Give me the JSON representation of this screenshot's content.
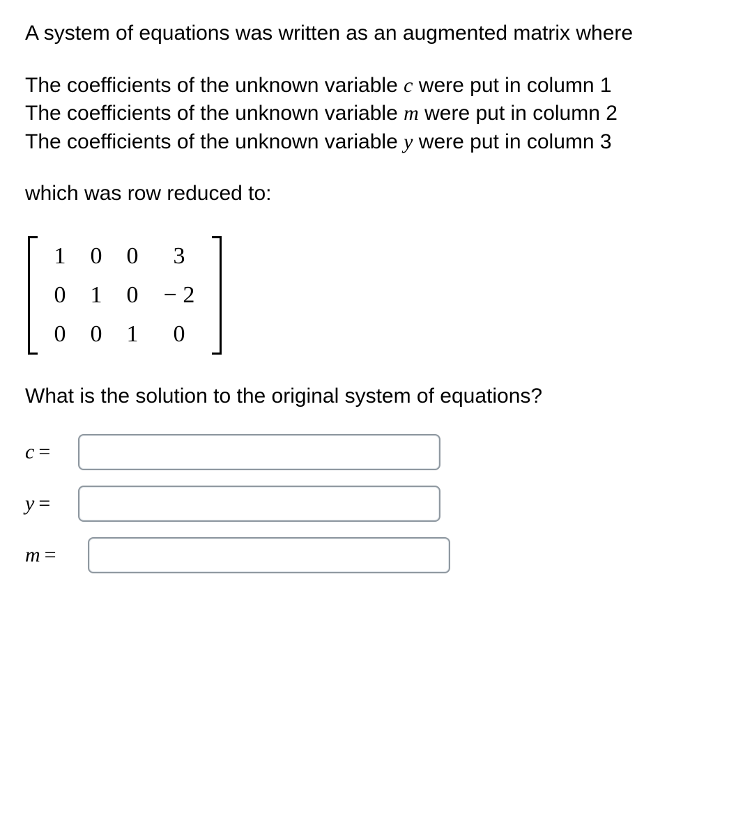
{
  "intro": "A system of equations was written as an augmented matrix where",
  "columns": {
    "line1_pre": "The coefficients of the unknown variable ",
    "line1_var": "c",
    "line1_post": " were put in column 1",
    "line2_pre": "The coefficients of the unknown variable ",
    "line2_var": "m",
    "line2_post": " were put in column 2",
    "line3_pre": "The coefficients of the unknown variable ",
    "line3_var": "y",
    "line3_post": " were put in column 3"
  },
  "reduced_label": "which was row reduced to:",
  "matrix": {
    "r1": [
      "1",
      "0",
      "0",
      "3"
    ],
    "r2": [
      "0",
      "1",
      "0",
      "− 2"
    ],
    "r3": [
      "0",
      "0",
      "1",
      "0"
    ]
  },
  "question": "What is the solution to the original system of equations?",
  "answers": {
    "c_label": "c",
    "y_label": "y",
    "m_label": "m",
    "eq": "=",
    "c_value": "",
    "y_value": "",
    "m_value": ""
  }
}
